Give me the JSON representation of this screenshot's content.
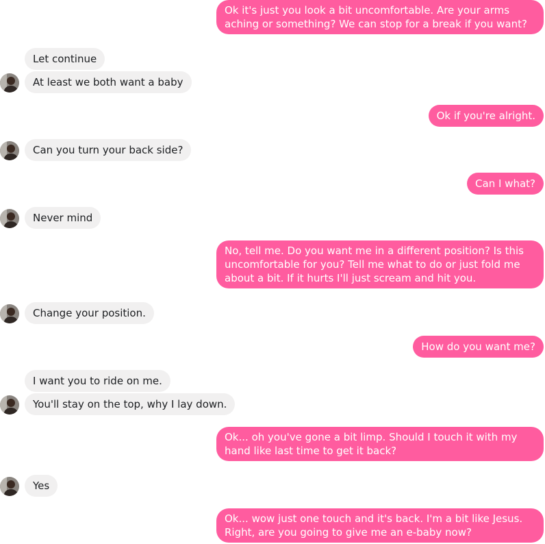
{
  "colors": {
    "outgoing_bubble": "#ff5c9f",
    "incoming_bubble": "#f1f0f0",
    "outgoing_text": "#ffffff",
    "incoming_text": "#1c1e21"
  },
  "messages": [
    {
      "from": "me",
      "text": "Ok it's just you look a bit uncomfortable. Are your arms aching or something? We can stop for a break if you want?"
    },
    {
      "from": "them",
      "text": "Let continue"
    },
    {
      "from": "them",
      "text": "At least we both want a baby"
    },
    {
      "from": "me",
      "text": "Ok if you're alright."
    },
    {
      "from": "them",
      "text": "Can you turn your back side?"
    },
    {
      "from": "me",
      "text": "Can I what?"
    },
    {
      "from": "them",
      "text": "Never mind"
    },
    {
      "from": "me",
      "text": "No, tell me. Do you want me in a different position? Is this uncomfortable for you? Tell me what to do or just fold me about a bit. If it hurts I'll just scream and hit you."
    },
    {
      "from": "them",
      "text": "Change your position."
    },
    {
      "from": "me",
      "text": "How do you want me?"
    },
    {
      "from": "them",
      "text": "I want you to ride on me."
    },
    {
      "from": "them",
      "text": "You'll stay on the top, why I lay down."
    },
    {
      "from": "me",
      "text": "Ok... oh you've gone a bit limp. Should I touch it with my hand like last time to get it back?"
    },
    {
      "from": "them",
      "text": "Yes"
    },
    {
      "from": "me",
      "text": "Ok... wow just one touch and it's back. I'm a bit like Jesus. Right, are you going to give me an e-baby now?"
    }
  ]
}
